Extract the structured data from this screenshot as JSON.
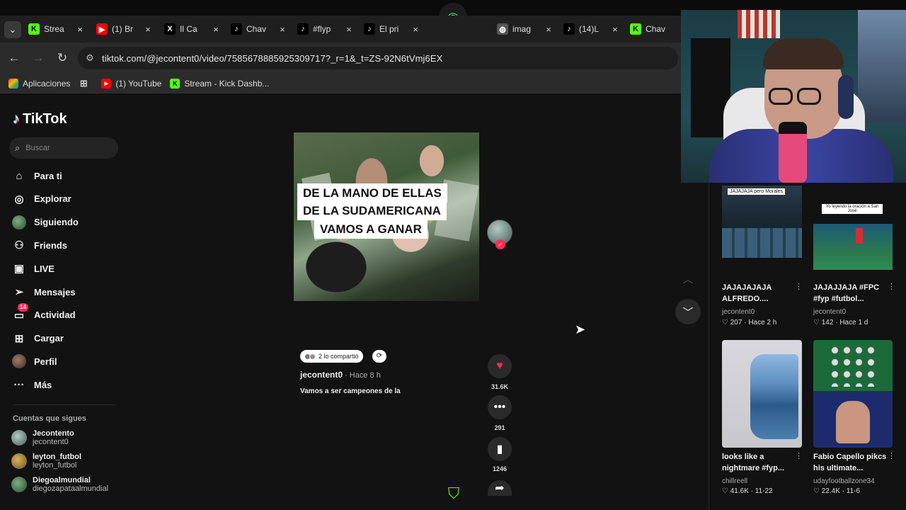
{
  "tabs": [
    {
      "title": "Strea",
      "icon": "kick-icon",
      "color": "#53fc18",
      "glyph": "K"
    },
    {
      "title": "(1) Br",
      "icon": "youtube-icon",
      "color": "#ff0000",
      "glyph": "▶"
    },
    {
      "title": "Il Ca",
      "icon": "x-icon",
      "color": "#000000",
      "glyph": "X"
    },
    {
      "title": "Chav",
      "icon": "tiktok-icon",
      "color": "#000000",
      "glyph": "♪"
    },
    {
      "title": "#flyp",
      "icon": "tiktok-icon",
      "color": "#000000",
      "glyph": "♪"
    },
    {
      "title": "El pri",
      "icon": "tiktok-icon",
      "color": "#000000",
      "glyph": "♪"
    },
    {
      "title": "imag",
      "icon": "globe-icon",
      "color": "#555555",
      "glyph": "◍"
    },
    {
      "title": "(14)L",
      "icon": "tiktok-icon",
      "color": "#000000",
      "glyph": "♪"
    },
    {
      "title": "Chav",
      "icon": "kick-icon",
      "color": "#53fc18",
      "glyph": "K"
    }
  ],
  "address": {
    "url": "tiktok.com/@jecontent0/video/7585678885925309717?_r=1&_t=ZS-92N6tVmj6EX"
  },
  "bookmarks": [
    {
      "label": "Aplicaciones",
      "icon": "apps-grid-icon"
    },
    {
      "label": "",
      "icon": "grid-icon"
    },
    {
      "label": "(1) YouTube",
      "icon": "youtube-icon"
    },
    {
      "label": "Stream - Kick Dashb...",
      "icon": "kick-icon"
    }
  ],
  "tiktok": {
    "logo": "TikTok",
    "search_placeholder": "Buscar",
    "nav": [
      {
        "label": "Para ti",
        "icon": "home-icon"
      },
      {
        "label": "Explorar",
        "icon": "compass-icon"
      },
      {
        "label": "Siguiendo",
        "icon": "following-avatar-icon"
      },
      {
        "label": "Friends",
        "icon": "friends-icon"
      },
      {
        "label": "LIVE",
        "icon": "live-icon"
      },
      {
        "label": "Mensajes",
        "icon": "send-icon"
      },
      {
        "label": "Actividad",
        "icon": "activity-icon",
        "badge": "14"
      },
      {
        "label": "Cargar",
        "icon": "upload-icon"
      },
      {
        "label": "Perfil",
        "icon": "profile-icon"
      },
      {
        "label": "Más",
        "icon": "more-icon"
      }
    ],
    "following_heading": "Cuentas que sigues",
    "following": [
      {
        "name": "Jecontento",
        "handle": "jecontent0"
      },
      {
        "name": "leyton_futbol",
        "handle": "leyton_futbol"
      },
      {
        "name": "Diegoalmundial",
        "handle": "diegozapataalmundial"
      }
    ]
  },
  "video": {
    "caption_lines": [
      "DE LA MANO DE ELLAS",
      "DE LA SUDAMERICANA",
      "VAMOS A GANAR"
    ],
    "likes": "31.6K",
    "comments": "291",
    "saves": "1246",
    "shared_text": "2 lo compartió",
    "author": "jecontent0",
    "posted": " · Hace 8 h",
    "description": "Vamos a ser campeones de la"
  },
  "recommended": [
    {
      "title": "JAJAJAJAJA ALFREDO....",
      "user": "jecontent0",
      "likes": "207",
      "time": "Hace 2 h",
      "overlay": "JAJAJAJA pero Morales"
    },
    {
      "title": "JAJAJJAJA #FPC #fyp #futbol...",
      "user": "jecontent0",
      "likes": "142",
      "time": "Hace 1 d",
      "overlay": "Yo leyendo la oración a San José"
    },
    {
      "title": "looks like a nightmare #fyp...",
      "user": "chillreell",
      "likes": "41.6K",
      "time": "11-22",
      "overlay": ""
    },
    {
      "title": "Fabio Capello pikcs his ultimate...",
      "user": "udayfootballzone34",
      "likes": "22.4K",
      "time": "11-6",
      "overlay": ""
    }
  ],
  "colors": {
    "like": "#fe2c55",
    "kick": "#53fc18"
  }
}
